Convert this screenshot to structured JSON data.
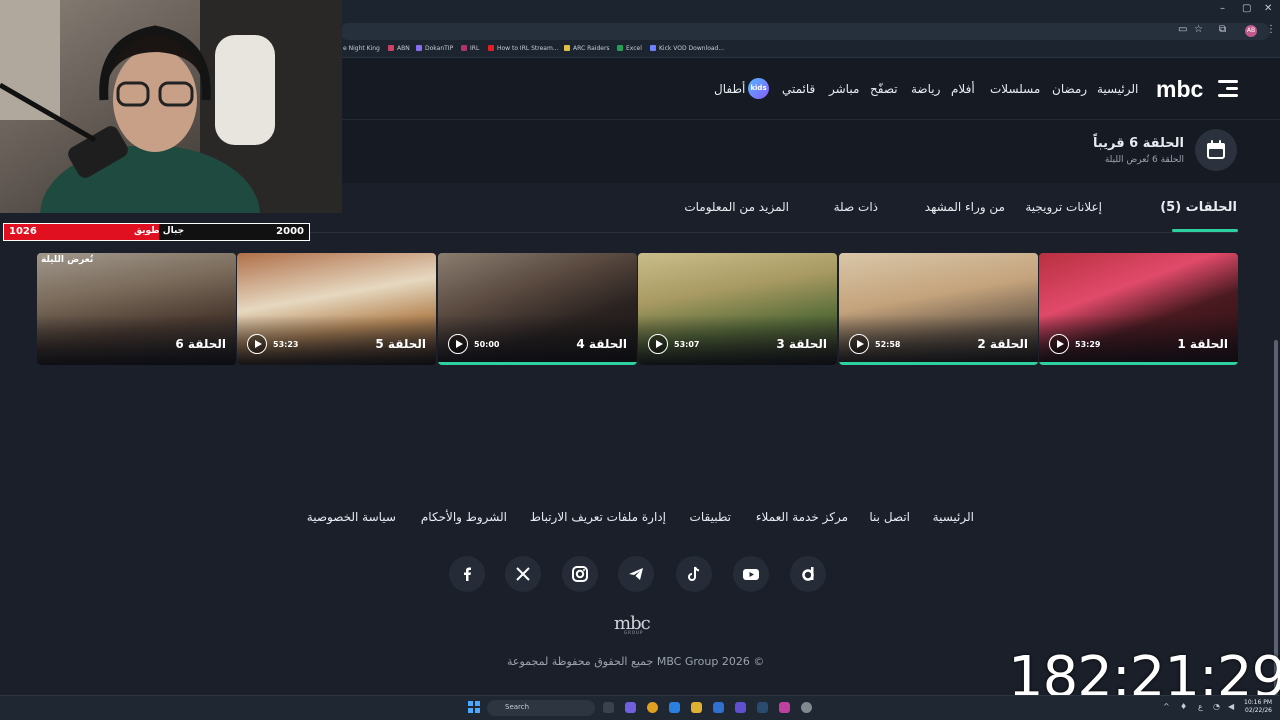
{
  "browser": {
    "window_controls": [
      "–",
      "▢",
      "✕"
    ],
    "bookmarks": [
      "e Night King",
      "ABN",
      "DokanTIP",
      "IRL",
      "How to IRL Stream...",
      "ARC Raiders",
      "Excel",
      "Kick VOD Download..."
    ],
    "profile_initials": "AB"
  },
  "header": {
    "logo": "mbc",
    "nav": [
      "الرئيسية",
      "رمضان",
      "مسلسلات",
      "أفلام",
      "رياضة",
      "تصفّح",
      "مباشر",
      "قائمتي",
      "أطفال"
    ],
    "kids_badge": "kids"
  },
  "next_episode": {
    "title": "الحلقة 6 قريباً",
    "subtitle": "الحلقة 6 تُعرض الليلة"
  },
  "tabs": {
    "episodes": "الحلقات (5)",
    "promos": "إعلانات ترويجية",
    "behind": "من وراء المشهد",
    "related": "ذات صلة",
    "more_info": "المزيد من المعلومات"
  },
  "episodes": [
    {
      "title": "الحلقة 1",
      "duration": "53:29",
      "progress": 1.0
    },
    {
      "title": "الحلقة 2",
      "duration": "52:58",
      "progress": 1.0
    },
    {
      "title": "الحلقة 3",
      "duration": "53:07",
      "progress": 0
    },
    {
      "title": "الحلقة 4",
      "duration": "50:00",
      "progress": 1.0
    },
    {
      "title": "الحلقة 5",
      "duration": "53:23",
      "progress": 0
    },
    {
      "title": "الحلقة 6",
      "badge": "تُعرض الليلة"
    }
  ],
  "footer": {
    "links": [
      "الرئيسية",
      "اتصل بنا",
      "مركز خدمة العملاء",
      "تطبيقات",
      "إدارة ملفات تعريف الارتباط",
      "الشروط والأحكام",
      "سياسة الخصوصية"
    ],
    "social_icons": [
      "d-icon",
      "youtube-icon",
      "tiktok-icon",
      "telegram-icon",
      "instagram-icon",
      "x-icon",
      "facebook-icon"
    ],
    "logo": "mbc",
    "logo_sub": "GROUP",
    "copyright": "جميع الحقوق محفوظة لمجموعة MBC Group 2026 ©"
  },
  "stream_overlay": {
    "left_value": "1026",
    "middle_left": "طويق",
    "middle_right": "جبال",
    "right_value": "2000",
    "timer": "182:21:29"
  },
  "taskbar": {
    "search": "Search",
    "time": "10:16 PM",
    "date": "02/22/26"
  },
  "colors": {
    "accent": "#2fd0a0",
    "background": "#151a23",
    "overlay_red": "#e01020"
  }
}
